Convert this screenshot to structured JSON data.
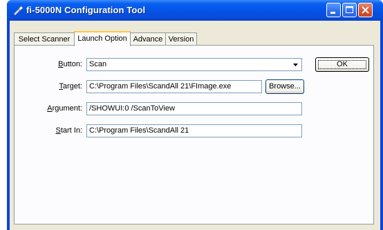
{
  "window": {
    "title": "fi-5000N Configuration Tool"
  },
  "tabs": [
    {
      "label": "Select Scanner",
      "active": false
    },
    {
      "label": "Launch Option",
      "active": true
    },
    {
      "label": "Advance",
      "active": false
    },
    {
      "label": "Version",
      "active": false
    }
  ],
  "form": {
    "button_label_ul": "B",
    "button_label_rest": "utton:",
    "button_value": "Scan",
    "target_label_ul": "T",
    "target_label_rest": "arget:",
    "target_value": "C:\\Program Files\\ScandAll 21\\FImage.exe",
    "argument_label_ul": "A",
    "argument_label_rest": "rgument:",
    "argument_value": "/SHOWUI:0  /ScanToView",
    "startin_label_ul": "S",
    "startin_label_rest": "tart In:",
    "startin_value": "C:\\Program Files\\ScandAll 21"
  },
  "buttons": {
    "ok": "OK",
    "browse": "Browse..."
  }
}
